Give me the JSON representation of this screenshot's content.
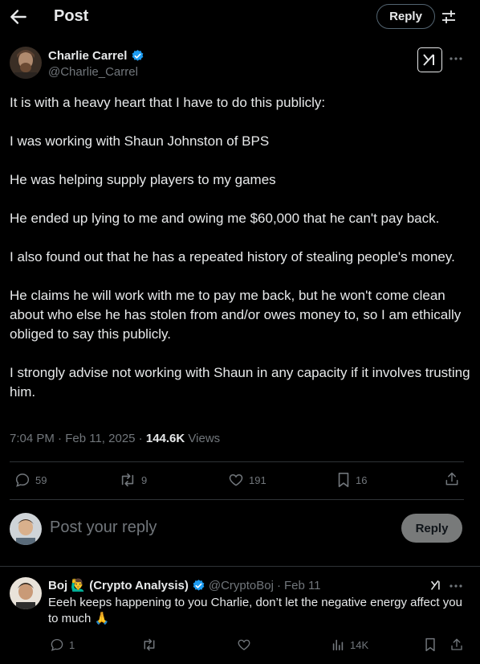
{
  "header": {
    "title": "Post",
    "reply_label": "Reply"
  },
  "author": {
    "name": "Charlie Carrel",
    "handle": "@Charlie_Carrel"
  },
  "tweet": {
    "paragraphs": [
      "It is with a heavy heart that I have to do this publicly:",
      "I was working with Shaun Johnston of BPS",
      "He was helping supply players to my games",
      "He ended up lying to me and owing me $60,000 that he can't pay back.",
      "I also found out that he has a repeated history of stealing people's money.",
      "He claims he will work with me to pay me back, but he won't come clean about who else he has stolen from and/or owes money to, so I am ethically obliged to say this publicly.",
      "I strongly advise not working with Shaun in any capacity if it involves trusting him."
    ],
    "time": "7:04 PM",
    "date": "Feb 11, 2025",
    "views_count": "144.6K",
    "views_label": "Views"
  },
  "stats": {
    "replies": "59",
    "reposts": "9",
    "likes": "191",
    "bookmarks": "16"
  },
  "composer": {
    "placeholder": "Post your reply",
    "button": "Reply"
  },
  "reply": {
    "name": "Boj",
    "emoji": "🙋‍♂️",
    "name_suffix": "(Crypto Analysis)",
    "handle": "@CryptoBoj",
    "separator": "·",
    "date": "Feb 11",
    "text": "Eeeh keeps happening to you Charlie, don’t let the negative energy affect you to much 🙏",
    "replies": "1",
    "views": "14K"
  },
  "colors": {
    "background": "#000000",
    "text": "#e7e9ea",
    "muted": "#71767b",
    "divider": "#2f3336",
    "verified": "#1d9bf0"
  }
}
